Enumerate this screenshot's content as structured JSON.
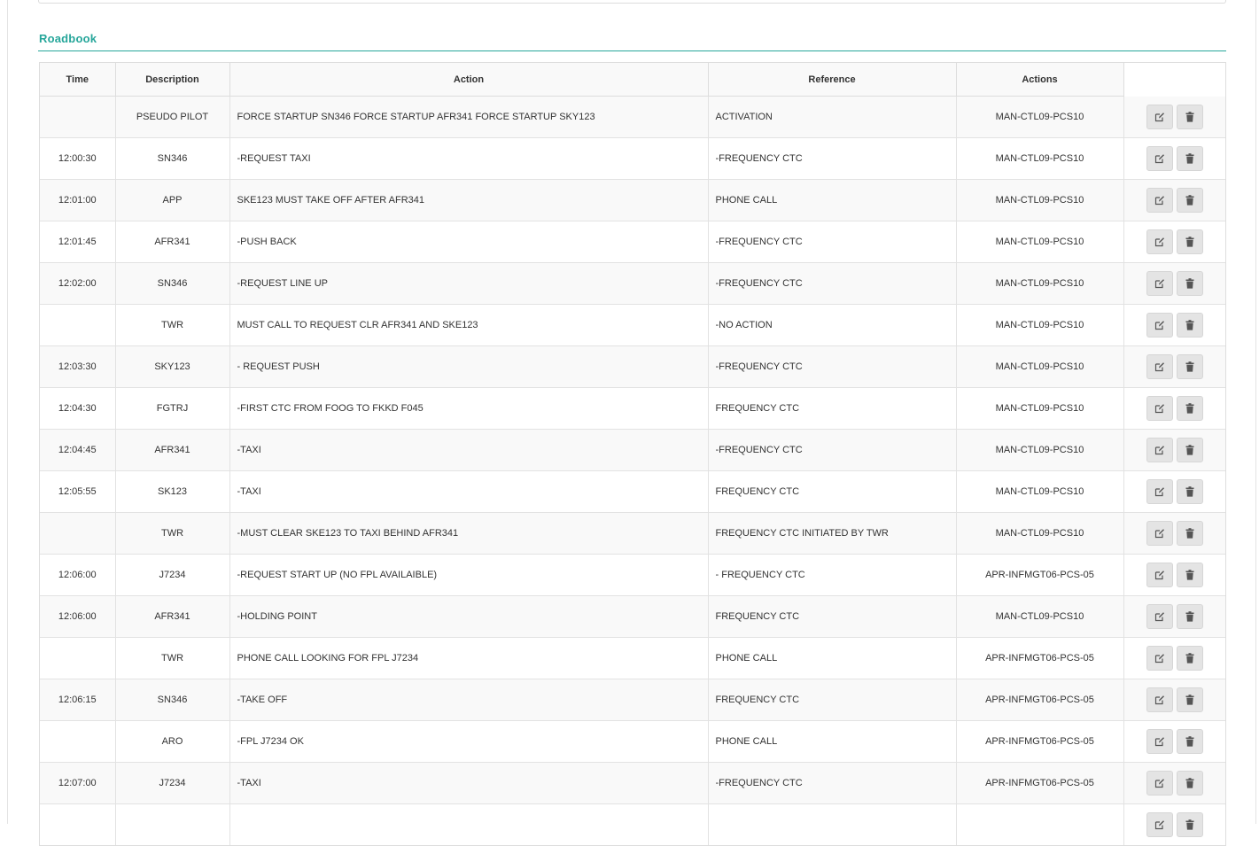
{
  "section": {
    "title": "Roadbook"
  },
  "table": {
    "headers": {
      "time": "Time",
      "description": "Description",
      "action": "Action",
      "reference": "Reference",
      "actions": "Actions"
    },
    "rows": [
      {
        "time": "",
        "description": "PSEUDO PILOT",
        "action": "FORCE STARTUP SN346 FORCE STARTUP AFR341 FORCE STARTUP SKY123",
        "reference": "ACTIVATION",
        "code": "MAN-CTL09-PCS10"
      },
      {
        "time": "12:00:30",
        "description": "SN346",
        "action": "-REQUEST TAXI",
        "reference": "-FREQUENCY CTC",
        "code": "MAN-CTL09-PCS10"
      },
      {
        "time": "12:01:00",
        "description": "APP",
        "action": "SKE123 MUST TAKE OFF AFTER AFR341",
        "reference": "PHONE CALL",
        "code": "MAN-CTL09-PCS10"
      },
      {
        "time": "12:01:45",
        "description": "AFR341",
        "action": "-PUSH BACK",
        "reference": "-FREQUENCY CTC",
        "code": "MAN-CTL09-PCS10"
      },
      {
        "time": "12:02:00",
        "description": "SN346",
        "action": "-REQUEST LINE UP",
        "reference": "-FREQUENCY CTC",
        "code": "MAN-CTL09-PCS10"
      },
      {
        "time": "",
        "description": "TWR",
        "action": "MUST CALL TO REQUEST CLR AFR341 AND SKE123",
        "reference": "-NO ACTION",
        "code": "MAN-CTL09-PCS10"
      },
      {
        "time": "12:03:30",
        "description": "SKY123",
        "action": "- REQUEST PUSH",
        "reference": "-FREQUENCY CTC",
        "code": "MAN-CTL09-PCS10"
      },
      {
        "time": "12:04:30",
        "description": "FGTRJ",
        "action": "-FIRST CTC FROM FOOG TO FKKD F045",
        "reference": "FREQUENCY CTC",
        "code": "MAN-CTL09-PCS10"
      },
      {
        "time": "12:04:45",
        "description": "AFR341",
        "action": "-TAXI",
        "reference": "-FREQUENCY CTC",
        "code": "MAN-CTL09-PCS10"
      },
      {
        "time": "12:05:55",
        "description": "SK123",
        "action": "-TAXI",
        "reference": "FREQUENCY CTC",
        "code": "MAN-CTL09-PCS10"
      },
      {
        "time": "",
        "description": "TWR",
        "action": "-MUST CLEAR SKE123 TO TAXI BEHIND AFR341",
        "reference": "FREQUENCY CTC INITIATED BY TWR",
        "code": "MAN-CTL09-PCS10"
      },
      {
        "time": "12:06:00",
        "description": "J7234",
        "action": "-REQUEST START UP (NO FPL AVAILAIBLE)",
        "reference": "- FREQUENCY CTC",
        "code": "APR-INFMGT06-PCS-05"
      },
      {
        "time": "12:06:00",
        "description": "AFR341",
        "action": "-HOLDING POINT",
        "reference": "FREQUENCY CTC",
        "code": "MAN-CTL09-PCS10"
      },
      {
        "time": "",
        "description": "TWR",
        "action": "PHONE CALL LOOKING FOR FPL J7234",
        "reference": "PHONE CALL",
        "code": "APR-INFMGT06-PCS-05"
      },
      {
        "time": "12:06:15",
        "description": "SN346",
        "action": "-TAKE OFF",
        "reference": "FREQUENCY CTC",
        "code": "APR-INFMGT06-PCS-05"
      },
      {
        "time": "",
        "description": "ARO",
        "action": "-FPL J7234 OK",
        "reference": "PHONE CALL",
        "code": "APR-INFMGT06-PCS-05"
      },
      {
        "time": "12:07:00",
        "description": "J7234",
        "action": "-TAXI",
        "reference": "-FREQUENCY CTC",
        "code": "APR-INFMGT06-PCS-05"
      },
      {
        "time": "",
        "description": "",
        "action": "",
        "reference": "",
        "code": ""
      }
    ]
  },
  "icons": {
    "edit": "edit-icon",
    "delete": "trash-icon"
  },
  "colors": {
    "accent": "#26a69a",
    "button_bg": "#e4e4e4",
    "stripe": "#f9f9f9"
  }
}
